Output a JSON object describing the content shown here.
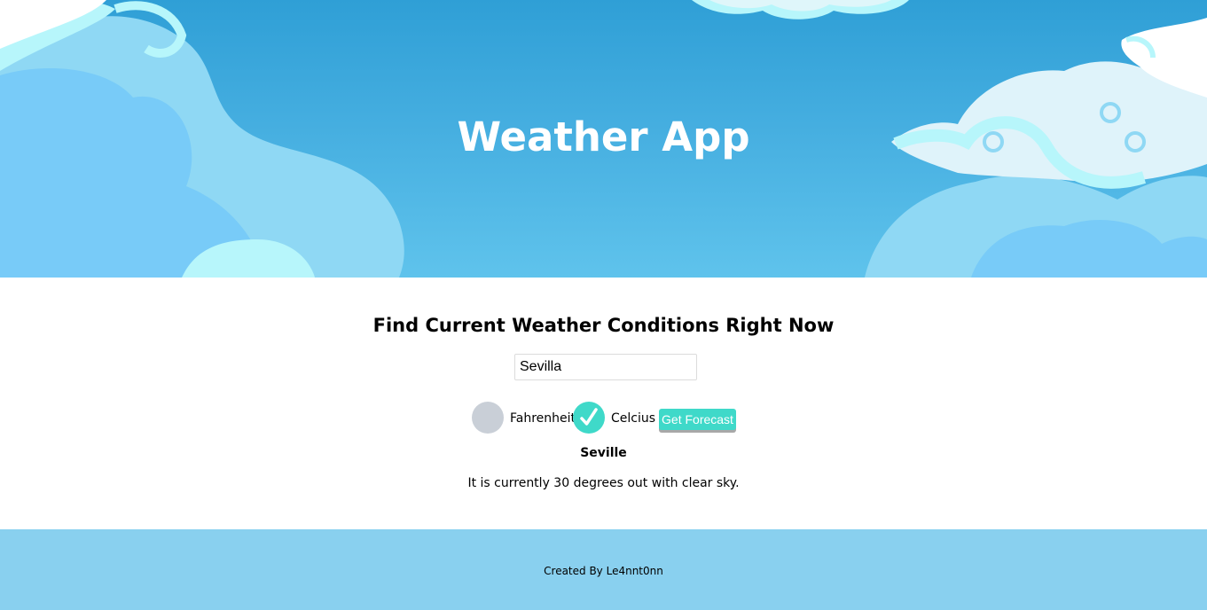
{
  "header": {
    "title": "Weather App"
  },
  "main": {
    "heading": "Find Current Weather Conditions Right Now",
    "search": {
      "value": "Sevilla",
      "placeholder": ""
    },
    "units": {
      "options": [
        "Fahrenheit",
        "Celcius"
      ],
      "selected": "Celcius"
    },
    "button_label": "Get Forecast",
    "result": {
      "city": "Seville",
      "description": "It is currently 30 degrees out with clear sky."
    }
  },
  "footer": {
    "credit": "Created By Le4nnt0nn"
  },
  "colors": {
    "sky_top": "#2f9fd6",
    "sky_bottom": "#5fc3ec",
    "accent": "#3fd9c9",
    "radio_off": "#c9cfd7",
    "footer_bg": "#89d0ef"
  },
  "icons": {
    "selected_radio": "checkmark-icon"
  }
}
